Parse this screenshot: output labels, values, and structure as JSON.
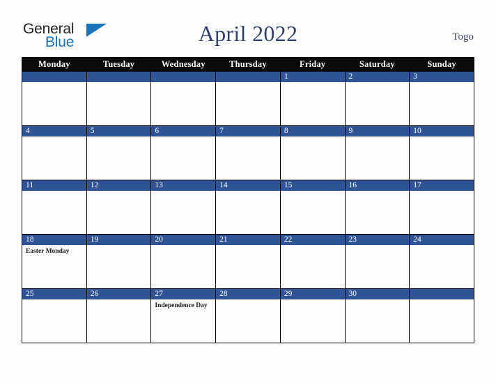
{
  "logo": {
    "word_one": "General",
    "word_two": "Blue",
    "triangle_icon": "triangle-icon",
    "blue_hex": "#1b75bb",
    "text_hex": "#231f20"
  },
  "header": {
    "title": "April 2022",
    "country": "Togo",
    "title_hex": "#2e4372"
  },
  "calendar": {
    "accent_hex": "#2f5496",
    "header_bg_hex": "#0b0b0b",
    "weekday_headers": [
      "Monday",
      "Tuesday",
      "Wednesday",
      "Thursday",
      "Friday",
      "Saturday",
      "Sunday"
    ],
    "weeks": [
      [
        {
          "date": "",
          "events": []
        },
        {
          "date": "",
          "events": []
        },
        {
          "date": "",
          "events": []
        },
        {
          "date": "",
          "events": []
        },
        {
          "date": "1",
          "events": []
        },
        {
          "date": "2",
          "events": []
        },
        {
          "date": "3",
          "events": []
        }
      ],
      [
        {
          "date": "4",
          "events": []
        },
        {
          "date": "5",
          "events": []
        },
        {
          "date": "6",
          "events": []
        },
        {
          "date": "7",
          "events": []
        },
        {
          "date": "8",
          "events": []
        },
        {
          "date": "9",
          "events": []
        },
        {
          "date": "10",
          "events": []
        }
      ],
      [
        {
          "date": "11",
          "events": []
        },
        {
          "date": "12",
          "events": []
        },
        {
          "date": "13",
          "events": []
        },
        {
          "date": "14",
          "events": []
        },
        {
          "date": "15",
          "events": []
        },
        {
          "date": "16",
          "events": []
        },
        {
          "date": "17",
          "events": []
        }
      ],
      [
        {
          "date": "18",
          "events": [
            "Easter Monday"
          ]
        },
        {
          "date": "19",
          "events": []
        },
        {
          "date": "20",
          "events": []
        },
        {
          "date": "21",
          "events": []
        },
        {
          "date": "22",
          "events": []
        },
        {
          "date": "23",
          "events": []
        },
        {
          "date": "24",
          "events": []
        }
      ],
      [
        {
          "date": "25",
          "events": []
        },
        {
          "date": "26",
          "events": []
        },
        {
          "date": "27",
          "events": [
            "Independence Day"
          ]
        },
        {
          "date": "28",
          "events": []
        },
        {
          "date": "29",
          "events": []
        },
        {
          "date": "30",
          "events": []
        },
        {
          "date": "",
          "events": []
        }
      ]
    ]
  }
}
